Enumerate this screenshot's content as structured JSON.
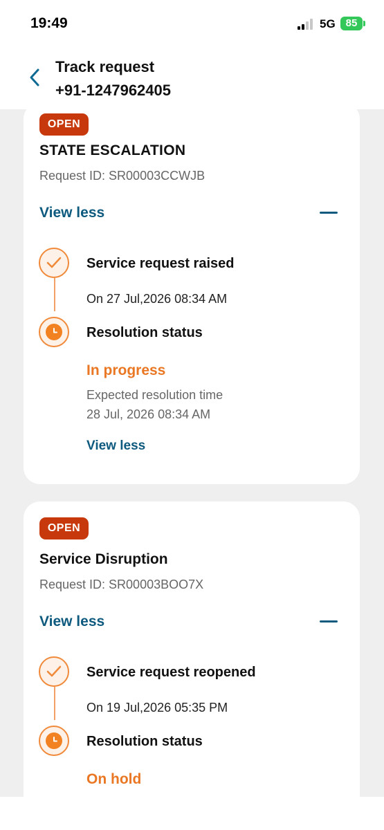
{
  "status_bar": {
    "time": "19:49",
    "network": "5G",
    "battery": "85"
  },
  "header": {
    "title": "Track request",
    "subtitle": "+91-1247962405"
  },
  "requests": [
    {
      "badge": "OPEN",
      "title": "STATE ESCALATION",
      "request_id": "Request ID: SR00003CCWJB",
      "toggle_label": "View less",
      "steps": [
        {
          "title": "Service request raised",
          "date": "On 27 Jul,2026 08:34 AM",
          "icon": "check-icon"
        },
        {
          "title": "Resolution status",
          "status": "In progress",
          "expected_label": "Expected resolution time",
          "expected_value": "28 Jul, 2026 08:34 AM",
          "link": "View less",
          "icon": "clock-icon"
        }
      ]
    },
    {
      "badge": "OPEN",
      "title": "Service Disruption",
      "request_id": "Request ID: SR00003BOO7X",
      "toggle_label": "View less",
      "steps": [
        {
          "title": "Service request reopened",
          "date": "On 19 Jul,2026 05:35 PM",
          "icon": "check-icon"
        },
        {
          "title": "Resolution status",
          "status": "On hold",
          "icon": "clock-icon"
        }
      ]
    }
  ],
  "colors": {
    "badge": "#c7390c",
    "accent_orange": "#ea7724",
    "link_blue": "#0d5a7e",
    "background": "#efefef"
  }
}
